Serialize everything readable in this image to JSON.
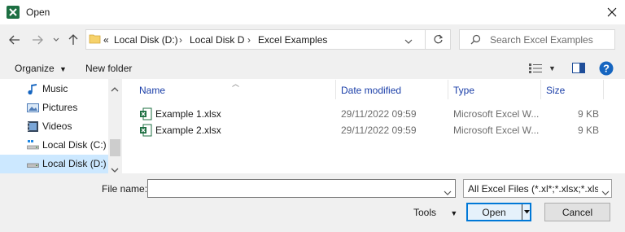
{
  "window": {
    "title": "Open",
    "app_icon": "excel-icon",
    "close_icon": "close-icon"
  },
  "nav": {
    "back_icon": "arrow-left-icon",
    "forward_icon": "arrow-right-icon",
    "recent_icon": "chevron-down-icon",
    "up_icon": "arrow-up-icon",
    "breadcrumb_overflow": "«",
    "breadcrumbs": [
      "Local Disk (D:)",
      "Local Disk D",
      "Excel Examples"
    ],
    "search_placeholder": "Search Excel Examples",
    "refresh_icon": "refresh-icon",
    "search_icon": "search-icon"
  },
  "toolbar": {
    "organize_label": "Organize",
    "new_folder_label": "New folder"
  },
  "sidebar": {
    "items": [
      {
        "label": "Music",
        "icon": "music-icon"
      },
      {
        "label": "Pictures",
        "icon": "pictures-icon"
      },
      {
        "label": "Videos",
        "icon": "videos-icon"
      },
      {
        "label": "Local Disk (C:)",
        "icon": "drive-icon"
      },
      {
        "label": "Local Disk (D:)",
        "icon": "drive-icon",
        "selected": true
      }
    ]
  },
  "filelist": {
    "columns": [
      "Name",
      "Date modified",
      "Type",
      "Size"
    ],
    "rows": [
      {
        "name": "Example 1.xlsx",
        "date": "29/11/2022 09:59",
        "type": "Microsoft Excel W...",
        "size": "9 KB"
      },
      {
        "name": "Example 2.xlsx",
        "date": "29/11/2022 09:59",
        "type": "Microsoft Excel W...",
        "size": "9 KB"
      }
    ]
  },
  "bottom": {
    "file_name_label": "File name:",
    "file_name_value": "",
    "filter_value": "All Excel Files (*.xl*;*.xlsx;*.xlsm",
    "tools_label": "Tools",
    "open_label": "Open",
    "cancel_label": "Cancel"
  },
  "colors": {
    "accent": "#0078d7",
    "selected_bg": "#cce8ff",
    "header_text": "#1a3ea8",
    "excel_green": "#1d6f42"
  }
}
